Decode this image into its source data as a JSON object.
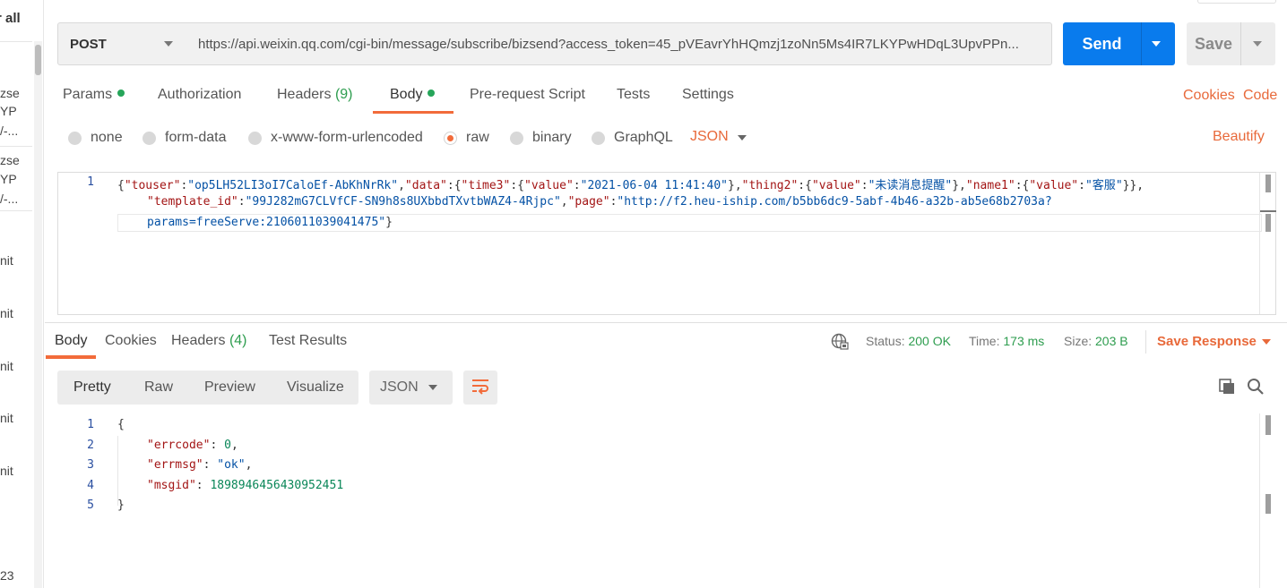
{
  "sidebar": {
    "view_all": "r all",
    "items": [
      {
        "l1": "zse",
        "l2": "YP",
        "l3": "/-..."
      },
      {
        "l1": "zse",
        "l2": "YP",
        "l3": "/-..."
      }
    ],
    "fragments": [
      "nit",
      "nit",
      "nit",
      "nit",
      "nit"
    ],
    "bottom": "23"
  },
  "request": {
    "method": "POST",
    "url": "https://api.weixin.qq.com/cgi-bin/message/subscribe/bizsend?access_token=45_pVEavrYhHQmzj1zoNn5Ms4IR7LKYPwHDqL3UpvPPn...",
    "send_label": "Send",
    "save_label": "Save"
  },
  "request_tabs": {
    "params": "Params",
    "authorization": "Authorization",
    "headers": "Headers",
    "headers_count": "(9)",
    "body": "Body",
    "pre_request": "Pre-request Script",
    "tests": "Tests",
    "settings": "Settings",
    "cookies": "Cookies",
    "code": "Code"
  },
  "body_types": {
    "none": "none",
    "form_data": "form-data",
    "urlencoded": "x-www-form-urlencoded",
    "raw": "raw",
    "binary": "binary",
    "graphql": "GraphQL",
    "format": "JSON",
    "beautify": "Beautify",
    "selected": "raw"
  },
  "request_body": {
    "line_numbers": [
      "1"
    ],
    "touser": "op5LH52LI3oI7CaloEf-AbKhNrRk",
    "time3": "2021-06-04 11:41:40",
    "thing2": "未读消息提醒",
    "name1": "客服",
    "template_id": "99J282mG7CLVfCF-SN9h8s8UXbbdTXvtbWAZ4-4Rjpc",
    "page_1": "http://f2.heu-iship.com/b5bb6dc9-5abf-4b46-a32b-ab5e68b2703a?",
    "page_2": "params=freeServe:2106011039041475"
  },
  "response_tabs": {
    "body": "Body",
    "cookies": "Cookies",
    "headers": "Headers",
    "headers_count": "(4)",
    "test_results": "Test Results"
  },
  "response_meta": {
    "status_label": "Status:",
    "status": "200 OK",
    "time_label": "Time:",
    "time": "173 ms",
    "size_label": "Size:",
    "size": "203 B",
    "save_response": "Save Response"
  },
  "view_modes": {
    "pretty": "Pretty",
    "raw": "Raw",
    "preview": "Preview",
    "visualize": "Visualize",
    "format": "JSON"
  },
  "response_body": {
    "line_numbers": [
      "1",
      "2",
      "3",
      "4",
      "5"
    ],
    "errcode": "0",
    "errmsg": "ok",
    "msgid": "1898946456430952451"
  },
  "colors": {
    "accent": "#f26b3a",
    "send": "#097bed",
    "success": "#2e9d4f"
  },
  "icons": [
    "caret-down-icon",
    "globe-icon",
    "wrap-lines-icon",
    "copy-icon",
    "search-icon"
  ]
}
